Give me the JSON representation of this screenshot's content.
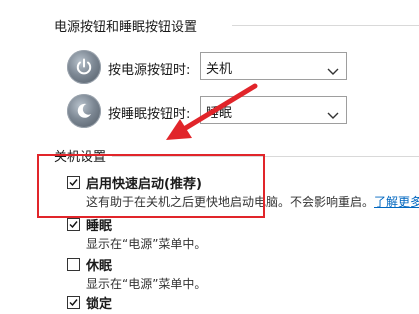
{
  "power_section": {
    "title": "电源按钮和睡眠按钮设置",
    "power_button_label": "按电源按钮时:",
    "power_button_value": "关机",
    "sleep_button_label": "按睡眠按钮时:",
    "sleep_button_value": "睡眠"
  },
  "shutdown_section": {
    "title": "关机设置",
    "items": [
      {
        "label": "启用快速启动(推荐)",
        "checked": true,
        "desc": "这有助于在关机之后更快地启动电脑。不会影响重启。",
        "link": "了解更多"
      },
      {
        "label": "睡眠",
        "checked": true,
        "desc": "显示在“电源”菜单中。"
      },
      {
        "label": "休眠",
        "checked": false,
        "desc": "显示在“电源”菜单中。"
      },
      {
        "label": "锁定",
        "checked": true
      }
    ]
  },
  "colors": {
    "highlight": "#e1252a",
    "link": "#0067c0"
  },
  "icons": [
    "power-icon",
    "sleep-icon",
    "chevron-down-icon",
    "checkmark-icon",
    "arrow-annotation"
  ]
}
